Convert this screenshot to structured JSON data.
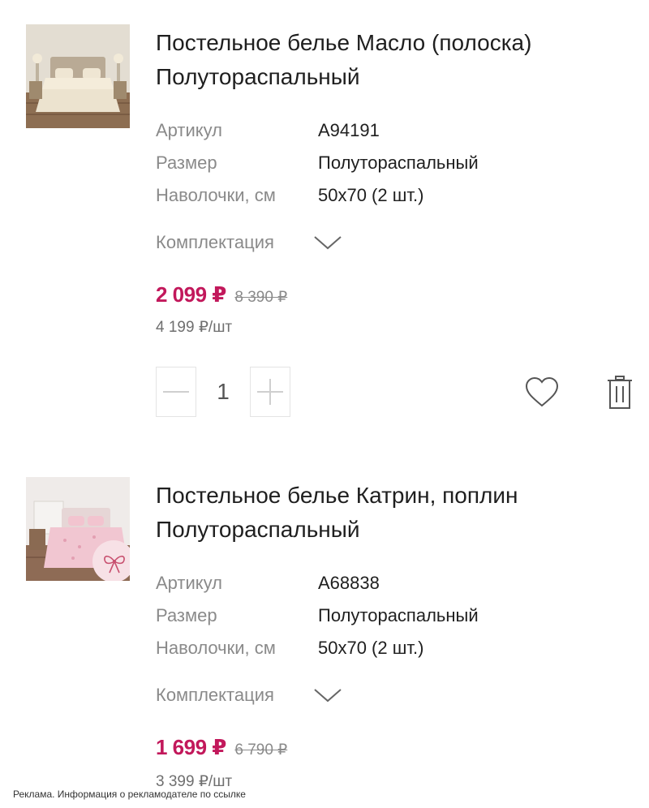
{
  "products": [
    {
      "title_line1": "Постельное белье Масло (полоска)",
      "title_line2": "Полутораспальный",
      "image": "bedroom-beige-bedding",
      "specs": [
        {
          "label": "Артикул",
          "value": "A94191"
        },
        {
          "label": "Размер",
          "value": "Полутораспальный"
        },
        {
          "label": "Наволочки, см",
          "value": "50x70 (2 шт.)"
        }
      ],
      "kit_label": "Комплектация",
      "price_current": "2 099 ₽",
      "price_old": "8 390 ₽",
      "price_per_unit": "4 199 ₽/шт",
      "quantity": "1",
      "icons": {
        "minus": "minus-icon",
        "plus": "plus-icon",
        "favorite": "heart-icon",
        "delete": "trash-icon",
        "kit": "chevron-down-icon"
      }
    },
    {
      "title_line1": "Постельное белье Катрин, поплин",
      "title_line2": "Полутораспальный",
      "image": "bedroom-pink-bedding",
      "badge_icon": "bow-icon",
      "specs": [
        {
          "label": "Артикул",
          "value": "A68838"
        },
        {
          "label": "Размер",
          "value": "Полутораспальный"
        },
        {
          "label": "Наволочки, см",
          "value": "50x70 (2 шт.)"
        }
      ],
      "kit_label": "Комплектация",
      "price_current": "1 699 ₽",
      "price_old": "6 790 ₽",
      "price_per_unit": "3 399 ₽/шт"
    }
  ],
  "ad_notice": "Реклама. Информация о рекламодателе по ссылке",
  "colors": {
    "price_accent": "#c2185b",
    "muted_text": "#8a8a8a",
    "border": "#e4e4e4"
  }
}
